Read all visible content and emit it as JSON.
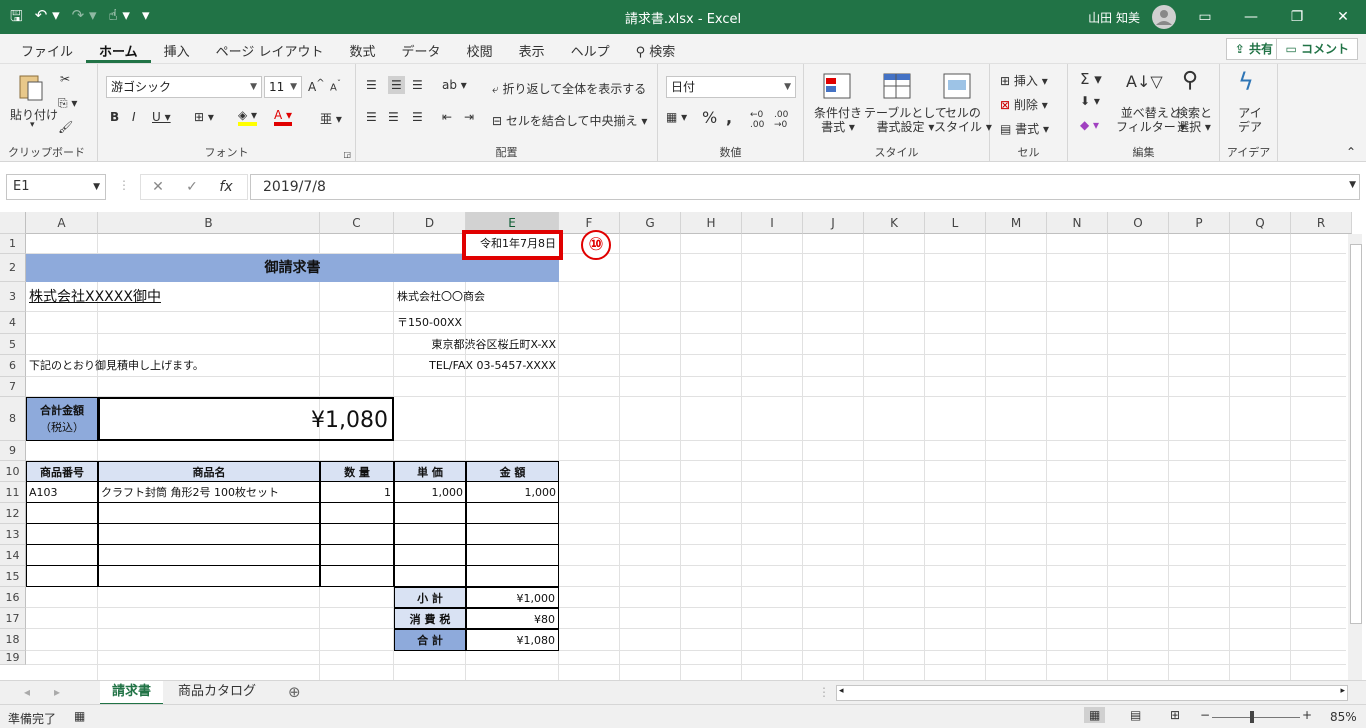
{
  "window": {
    "title": "請求書.xlsx  -  Excel",
    "user": "山田 知美"
  },
  "menu": {
    "tabs": [
      "ファイル",
      "ホーム",
      "挿入",
      "ページ レイアウト",
      "数式",
      "データ",
      "校閲",
      "表示",
      "ヘルプ",
      "検索"
    ],
    "share": "共有",
    "comment": "コメント"
  },
  "ribbon": {
    "clipboard": {
      "paste": "貼り付け",
      "label": "クリップボード"
    },
    "font": {
      "name": "游ゴシック",
      "size": "11",
      "label": "フォント"
    },
    "align": {
      "wrap": "折り返して全体を表示する",
      "merge": "セルを結合して中央揃え",
      "label": "配置"
    },
    "number": {
      "format": "日付",
      "label": "数値"
    },
    "style": {
      "cond1": "条件付き",
      "cond2": "書式",
      "table1": "テーブルとして",
      "table2": "書式設定",
      "cell1": "セルの",
      "cell2": "スタイル",
      "label": "スタイル"
    },
    "cells": {
      "insert": "挿入",
      "delete": "削除",
      "format": "書式",
      "label": "セル"
    },
    "edit": {
      "sort1": "並べ替えと",
      "sort2": "フィルター",
      "find1": "検索と",
      "find2": "選択",
      "label": "編集"
    },
    "ideas": {
      "l1": "アイ",
      "l2": "デア",
      "label": "アイデア"
    }
  },
  "formula": {
    "namebox": "E1",
    "value": "2019/7/8"
  },
  "columns": [
    "A",
    "B",
    "C",
    "D",
    "E",
    "F",
    "G",
    "H",
    "I",
    "J",
    "K",
    "L",
    "M",
    "N",
    "O",
    "P",
    "Q",
    "R"
  ],
  "rows": [
    "1",
    "2",
    "3",
    "4",
    "5",
    "6",
    "7",
    "8",
    "9",
    "10",
    "11",
    "12",
    "13",
    "14",
    "15",
    "16",
    "17",
    "18",
    "19"
  ],
  "sheet": {
    "date": "令和1年7月8日",
    "title": "御請求書",
    "client": "株式会社XXXXX御中",
    "company": "株式会社〇〇商会",
    "zip": "〒150-00XX",
    "address": "東京都渋谷区桜丘町X-XX",
    "tel": "TEL/FAX 03-5457-XXXX",
    "note": "下記のとおり御見積申し上げます。",
    "total_label1": "合計金額",
    "total_label2": "（税込）",
    "total_value": "¥1,080",
    "headers": [
      "商品番号",
      "商品名",
      "数 量",
      "単 価",
      "金 額"
    ],
    "item": {
      "code": "A103",
      "name": "クラフト封筒 角形2号 100枚セット",
      "qty": "1",
      "price": "1,000",
      "amount": "1,000"
    },
    "subtotal_label": "小 計",
    "subtotal": "¥1,000",
    "tax_label": "消 費 税",
    "tax": "¥80",
    "sum_label": "合 計",
    "sum": "¥1,080"
  },
  "callout_number": "⑩",
  "sheets": [
    "請求書",
    "商品カタログ"
  ],
  "status": {
    "ready": "準備完了",
    "zoom": "85%"
  }
}
